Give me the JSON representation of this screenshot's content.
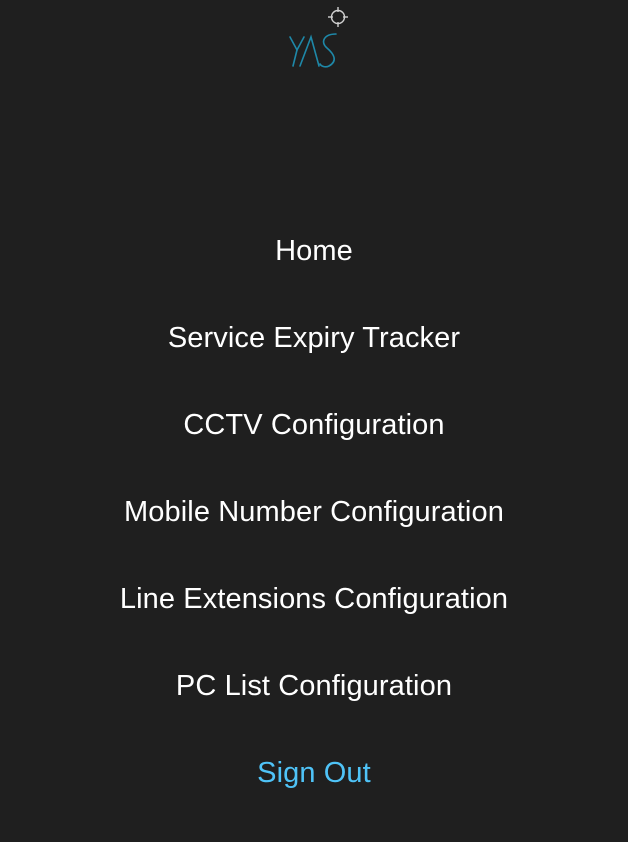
{
  "brand": {
    "logo_text": "YAS",
    "logo_color": "#1e88a8",
    "accent_icon": "crosshair-icon"
  },
  "nav": {
    "items": [
      {
        "label": "Home"
      },
      {
        "label": "Service Expiry Tracker"
      },
      {
        "label": "CCTV Configuration"
      },
      {
        "label": "Mobile Number Configuration"
      },
      {
        "label": "Line Extensions Configuration"
      },
      {
        "label": "PC List Configuration"
      }
    ],
    "sign_out_label": "Sign Out"
  },
  "colors": {
    "background": "#1f1f1f",
    "text": "#ffffff",
    "link_accent": "#4fc3f7"
  }
}
